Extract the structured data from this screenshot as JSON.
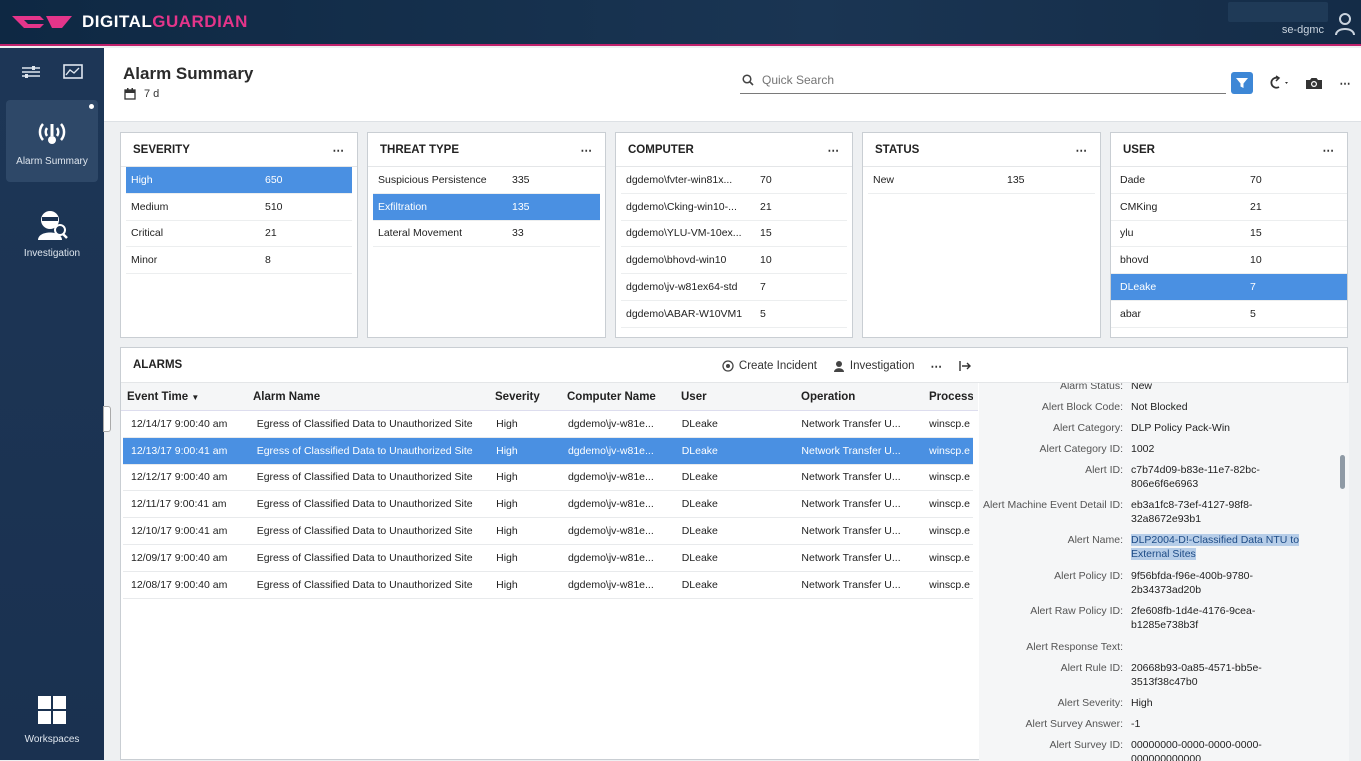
{
  "app": {
    "brand_digital": "DIGITAL",
    "brand_guardian": "GUARDIAN",
    "user": "se-dgmc"
  },
  "nav": {
    "items": [
      {
        "label": "Alarm Summary"
      },
      {
        "label": "Investigation"
      },
      {
        "label": "Workspaces"
      }
    ]
  },
  "header": {
    "title": "Alarm Summary",
    "date_range": "7 d",
    "search_placeholder": "Quick Search"
  },
  "facets": {
    "severity": {
      "title": "SEVERITY",
      "rows": [
        {
          "name": "High",
          "count": "650"
        },
        {
          "name": "Medium",
          "count": "510"
        },
        {
          "name": "Critical",
          "count": "21"
        },
        {
          "name": "Minor",
          "count": "8"
        }
      ]
    },
    "threat": {
      "title": "THREAT TYPE",
      "rows": [
        {
          "name": "Suspicious Persistence",
          "count": "335"
        },
        {
          "name": "Exfiltration",
          "count": "135"
        },
        {
          "name": "Lateral Movement",
          "count": "33"
        }
      ]
    },
    "computer": {
      "title": "COMPUTER",
      "rows": [
        {
          "name": "dgdemo\\fvter-win81x...",
          "count": "70"
        },
        {
          "name": "dgdemo\\Cking-win10-...",
          "count": "21"
        },
        {
          "name": "dgdemo\\YLU-VM-10ex...",
          "count": "15"
        },
        {
          "name": "dgdemo\\bhovd-win10",
          "count": "10"
        },
        {
          "name": "dgdemo\\jv-w81ex64-std",
          "count": "7"
        },
        {
          "name": "dgdemo\\ABAR-W10VM1",
          "count": "5"
        }
      ]
    },
    "status": {
      "title": "STATUS",
      "rows": [
        {
          "name": "New",
          "count": "135"
        }
      ]
    },
    "user": {
      "title": "USER",
      "rows": [
        {
          "name": "Dade",
          "count": "70"
        },
        {
          "name": "CMKing",
          "count": "21"
        },
        {
          "name": "ylu",
          "count": "15"
        },
        {
          "name": "bhovd",
          "count": "10"
        },
        {
          "name": "DLeake",
          "count": "7"
        },
        {
          "name": "abar",
          "count": "5"
        }
      ]
    }
  },
  "alarms": {
    "title": "ALARMS",
    "create_incident": "Create Incident",
    "investigation": "Investigation",
    "columns": [
      "Event Time",
      "Alarm Name",
      "Severity",
      "Computer Name",
      "User",
      "Operation",
      "Process"
    ],
    "rows": [
      {
        "time": "12/14/17 9:00:40 am",
        "name": "Egress of Classified Data to Unauthorized Site",
        "sev": "High",
        "comp": "dgdemo\\jv-w81e...",
        "user": "DLeake",
        "op": "Network Transfer U...",
        "proc": "winscp.e"
      },
      {
        "time": "12/13/17 9:00:41 am",
        "name": "Egress of Classified Data to Unauthorized Site",
        "sev": "High",
        "comp": "dgdemo\\jv-w81e...",
        "user": "DLeake",
        "op": "Network Transfer U...",
        "proc": "winscp.e"
      },
      {
        "time": "12/12/17 9:00:40 am",
        "name": "Egress of Classified Data to Unauthorized Site",
        "sev": "High",
        "comp": "dgdemo\\jv-w81e...",
        "user": "DLeake",
        "op": "Network Transfer U...",
        "proc": "winscp.e"
      },
      {
        "time": "12/11/17 9:00:41 am",
        "name": "Egress of Classified Data to Unauthorized Site",
        "sev": "High",
        "comp": "dgdemo\\jv-w81e...",
        "user": "DLeake",
        "op": "Network Transfer U...",
        "proc": "winscp.e"
      },
      {
        "time": "12/10/17 9:00:41 am",
        "name": "Egress of Classified Data to Unauthorized Site",
        "sev": "High",
        "comp": "dgdemo\\jv-w81e...",
        "user": "DLeake",
        "op": "Network Transfer U...",
        "proc": "winscp.e"
      },
      {
        "time": "12/09/17 9:00:40 am",
        "name": "Egress of Classified Data to Unauthorized Site",
        "sev": "High",
        "comp": "dgdemo\\jv-w81e...",
        "user": "DLeake",
        "op": "Network Transfer U...",
        "proc": "winscp.e"
      },
      {
        "time": "12/08/17 9:00:40 am",
        "name": "Egress of Classified Data to Unauthorized Site",
        "sev": "High",
        "comp": "dgdemo\\jv-w81e...",
        "user": "DLeake",
        "op": "Network Transfer U...",
        "proc": "winscp.e"
      }
    ]
  },
  "details": [
    {
      "k": "Alarm Status:",
      "v1": "New",
      "v2": ""
    },
    {
      "k": "Alert Block Code:",
      "v1": "Not Blocked",
      "v2": ""
    },
    {
      "k": "Alert Category:",
      "v1": "DLP Policy Pack-Win",
      "v2": ""
    },
    {
      "k": "Alert Category ID:",
      "v1": "1002",
      "v2": ""
    },
    {
      "k": "Alert ID:",
      "v1": "c7b74d09-b83e-11e7-82bc-",
      "v2": "806e6f6e6963"
    },
    {
      "k": "Alert Machine Event Detail ID:",
      "v1": "eb3a1fc8-73ef-4127-98f8-",
      "v2": "32a8672e93b1"
    },
    {
      "k": "Alert Name:",
      "v1": "DLP2004-D!-Classified Data NTU to",
      "v2": "External Sites"
    },
    {
      "k": "Alert Policy ID:",
      "v1": "9f56bfda-f96e-400b-9780-",
      "v2": "2b34373ad20b"
    },
    {
      "k": "Alert Raw Policy ID:",
      "v1": "2fe608fb-1d4e-4176-9cea-",
      "v2": "b1285e738b3f"
    },
    {
      "k": "Alert Response Text:",
      "v1": "",
      "v2": ""
    },
    {
      "k": "Alert Rule ID:",
      "v1": "20668b93-0a85-4571-bb5e-",
      "v2": "3513f38c47b0"
    },
    {
      "k": "Alert Severity:",
      "v1": "High",
      "v2": ""
    },
    {
      "k": "Alert Survey Answer:",
      "v1": "-1",
      "v2": ""
    },
    {
      "k": "Alert Survey ID:",
      "v1": "00000000-0000-0000-0000-",
      "v2": "000000000000"
    }
  ],
  "colors": {
    "accent": "#4a90e2",
    "brand_pink": "#e4358a",
    "nav_bg": "#1d3656"
  }
}
